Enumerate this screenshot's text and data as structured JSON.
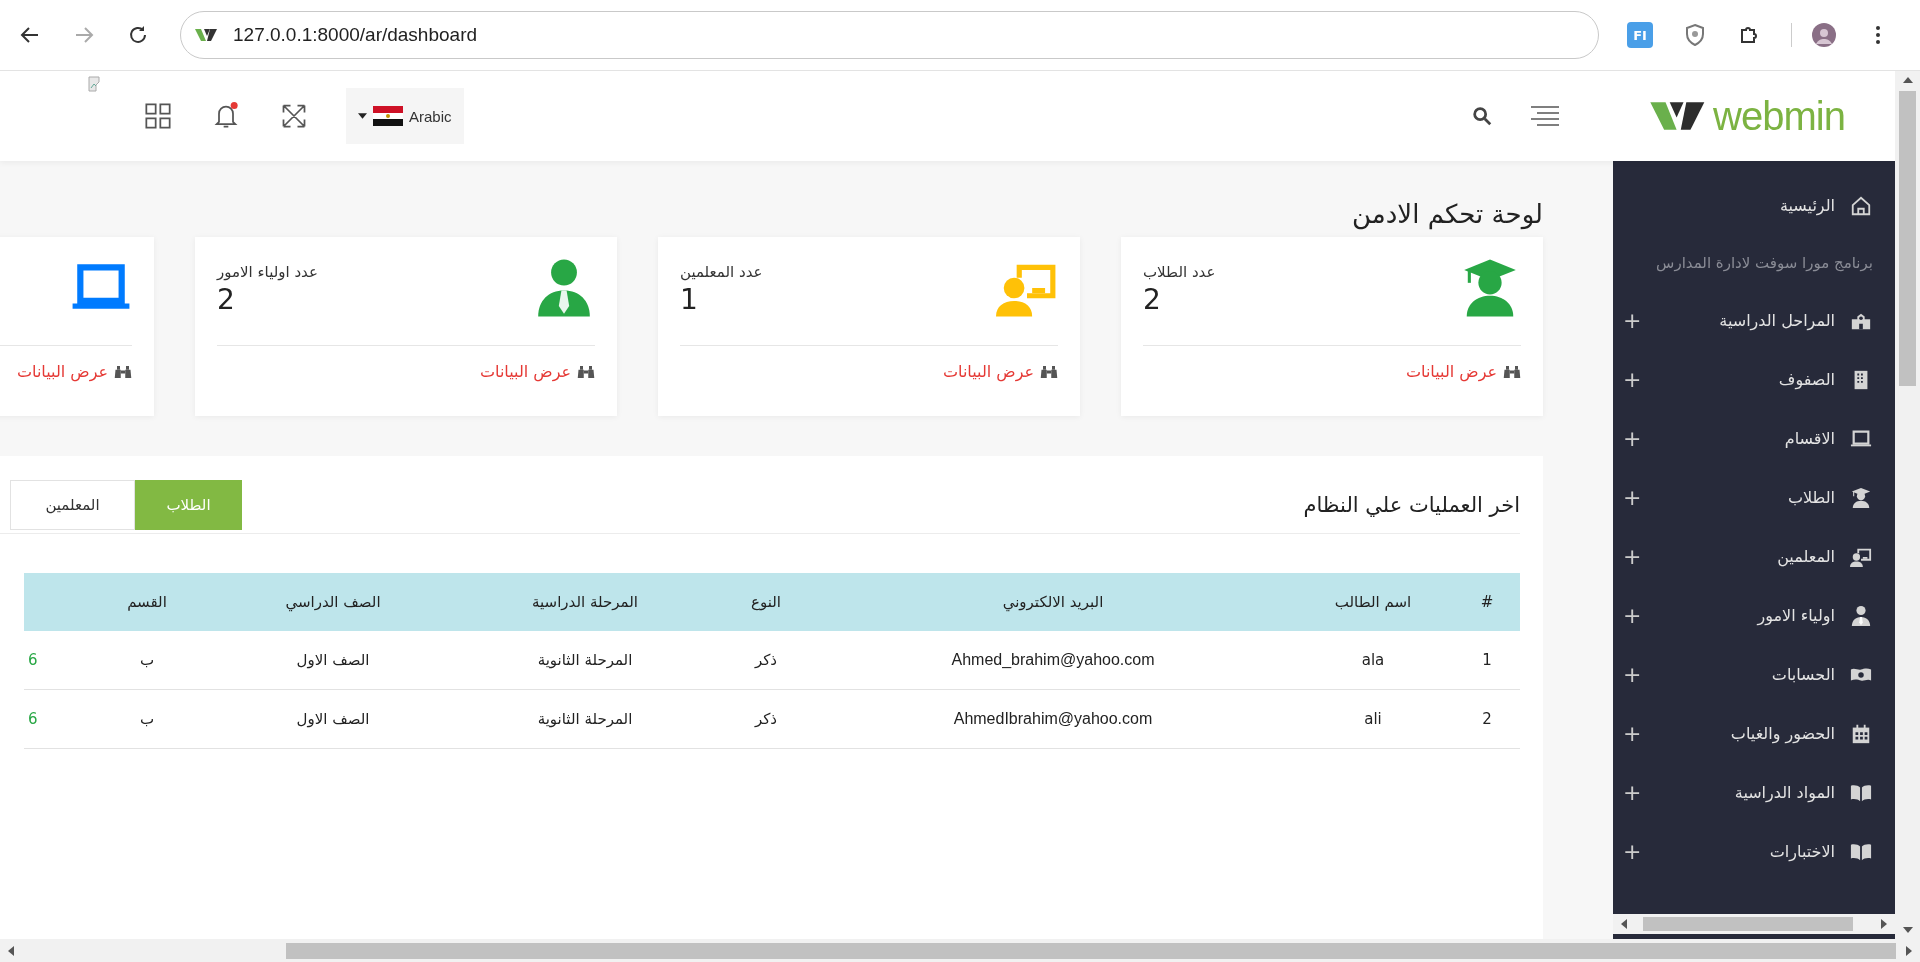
{
  "browser": {
    "url": "127.0.0.1:8000/ar/dashboard",
    "extension_label": "FI"
  },
  "header": {
    "logo_text": "webmin",
    "language": "Arabic",
    "notification_dot": true
  },
  "sidebar": {
    "items": [
      {
        "kind": "link",
        "label": "الرئيسية"
      },
      {
        "kind": "caption",
        "label": "برنامج مورا سوفت لادارة المدارس"
      },
      {
        "kind": "group",
        "label": "المراحل الدراسية",
        "toggle": "+"
      },
      {
        "kind": "group",
        "label": "الصفوف",
        "toggle": "+"
      },
      {
        "kind": "group",
        "label": "الاقسام",
        "toggle": "+"
      },
      {
        "kind": "group",
        "label": "الطلاب",
        "toggle": "+"
      },
      {
        "kind": "group",
        "label": "المعلمين",
        "toggle": "+"
      },
      {
        "kind": "group",
        "label": "اولياء الامور",
        "toggle": "+"
      },
      {
        "kind": "group",
        "label": "الحسابات",
        "toggle": "+"
      },
      {
        "kind": "group",
        "label": "الحضور والغياب",
        "toggle": "+"
      },
      {
        "kind": "group",
        "label": "المواد الدراسية",
        "toggle": "+"
      },
      {
        "kind": "group",
        "label": "الاختبارات",
        "toggle": "+"
      }
    ]
  },
  "page_title": "لوحة تحكم الادمن",
  "cards": [
    {
      "label": "عدد الطلاب",
      "value": "2",
      "color": "#28a745",
      "link": "عرض البيانات"
    },
    {
      "label": "عدد المعلمين",
      "value": "1",
      "color": "#ffc107",
      "link": "عرض البيانات"
    },
    {
      "label": "عدد اولياء الامور",
      "value": "2",
      "color": "#28a745",
      "link": "عرض البيانات"
    },
    {
      "color": "#007bff",
      "link": "عرض البيانات"
    }
  ],
  "recent": {
    "title": "اخر العمليات علي النظام",
    "tabs": [
      {
        "label": "الطلاب",
        "selected": true
      },
      {
        "label": "المعلمين",
        "selected": false
      }
    ],
    "table": {
      "columns": [
        "#",
        "اسم الطالب",
        "البريد الالكتروني",
        "النوع",
        "المرحلة الدراسية",
        "الصف الدراسي",
        "القسم"
      ],
      "rows": [
        {
          "cells": [
            "1",
            "ala",
            "Ahmed_brahim@yahoo.com",
            "ذكر",
            "المرحلة الثانوية",
            "الصف الاول",
            "ب",
            "6"
          ]
        },
        {
          "cells": [
            "2",
            "ali",
            "AhmedIbrahim@yahoo.com",
            "ذكر",
            "المرحلة الثانوية",
            "الصف الاول",
            "ب",
            "6"
          ]
        }
      ]
    }
  }
}
